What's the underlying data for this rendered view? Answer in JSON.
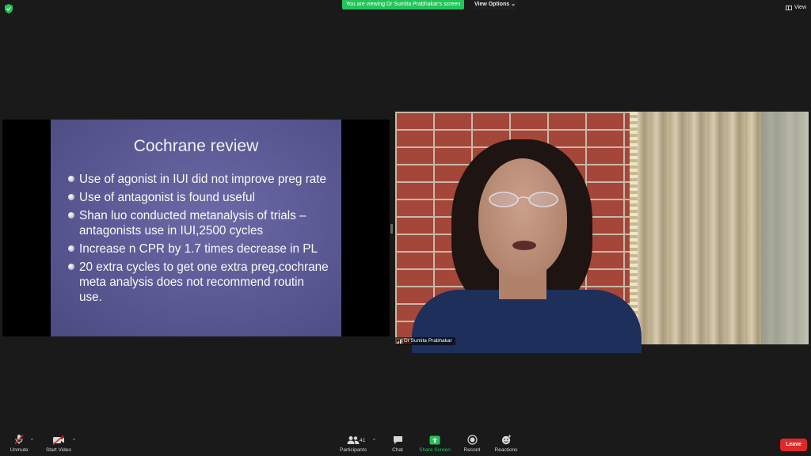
{
  "top_bar": {
    "viewing_banner": "You are viewing Dr Sumita Prabhakar's screen",
    "view_options": "View Options",
    "view": "View",
    "colors": {
      "banner": "#23c45a",
      "shield": "#23c45a"
    },
    "icons": [
      "shield-icon",
      "chevron-down-icon",
      "grid-view-icon"
    ]
  },
  "slide": {
    "title": "Cochrane review",
    "bullets": [
      "Use of agonist in IUI did not improve  preg rate",
      "Use of antagonist  is found useful",
      "Shan luo conducted   metanalysis of trials –antagonists use  in IUI,2500 cycles",
      "Increase n CPR by 1.7 times decrease in PL",
      "20 extra cycles to get one extra preg,cochrane meta analysis does not recommend routin use."
    ]
  },
  "video": {
    "participant_name": "Dr Sumita Prabhakar"
  },
  "toolbar": {
    "unmute": "Unmute",
    "start_video": "Start Video",
    "participants": "Participants",
    "participant_count": "41",
    "chat": "Chat",
    "share_screen": "Share Screen",
    "record": "Record",
    "reactions": "Reactions",
    "leave": "Leave",
    "colors": {
      "share": "#23c45a",
      "leave": "#e02828"
    },
    "icons": [
      "muted-mic-icon",
      "video-off-icon",
      "participants-icon",
      "chat-icon",
      "share-screen-icon",
      "record-icon",
      "reactions-icon"
    ]
  }
}
